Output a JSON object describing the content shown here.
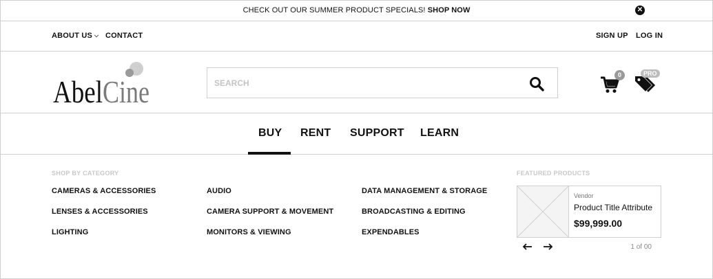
{
  "promo": {
    "text": "CHECK OUT OUR SUMMER PRODUCT SPECIALS! ",
    "cta": "SHOP NOW",
    "close_icon": "close-icon"
  },
  "utility_nav": {
    "about": "ABOUT US",
    "contact": "CONTACT",
    "sign_up": "SIGN UP",
    "log_in": "LOG IN"
  },
  "header": {
    "logo_text_a": "Abel",
    "logo_text_b": "Cine",
    "search_placeholder": "SEARCH",
    "search_value": "",
    "search_icon": "search-icon",
    "cart_count": "0",
    "cart_icon": "cart-icon",
    "pro_badge": "PRO",
    "pro_icon": "tags-icon"
  },
  "main_nav": {
    "tabs": [
      {
        "label": "BUY",
        "active": true
      },
      {
        "label": "RENT"
      },
      {
        "label": "SUPPORT"
      },
      {
        "label": "LEARN"
      }
    ]
  },
  "mega_menu": {
    "shop_title": "SHOP BY CATEGORY",
    "categories": [
      "CAMERAS & ACCESSORIES",
      "LENSES & ACCESSORIES",
      "LIGHTING",
      "AUDIO",
      "CAMERA SUPPORT & MOVEMENT",
      "MONITORS & VIEWING",
      "DATA MANAGEMENT & STORAGE",
      "BROADCASTING & EDITING",
      "EXPENDABLES"
    ],
    "featured_title": "FEATURED PRODUCTS",
    "featured": {
      "vendor": "Vendor",
      "title": "Product Title Attribute",
      "price": "$99,999.00",
      "pager": "1 of 00"
    }
  },
  "colors": {
    "text": "#111111",
    "border": "#cfcfcf",
    "muted": "#c8c8c8",
    "badge": "#9a9a9a",
    "logo_cine": "#7a7a7a"
  }
}
